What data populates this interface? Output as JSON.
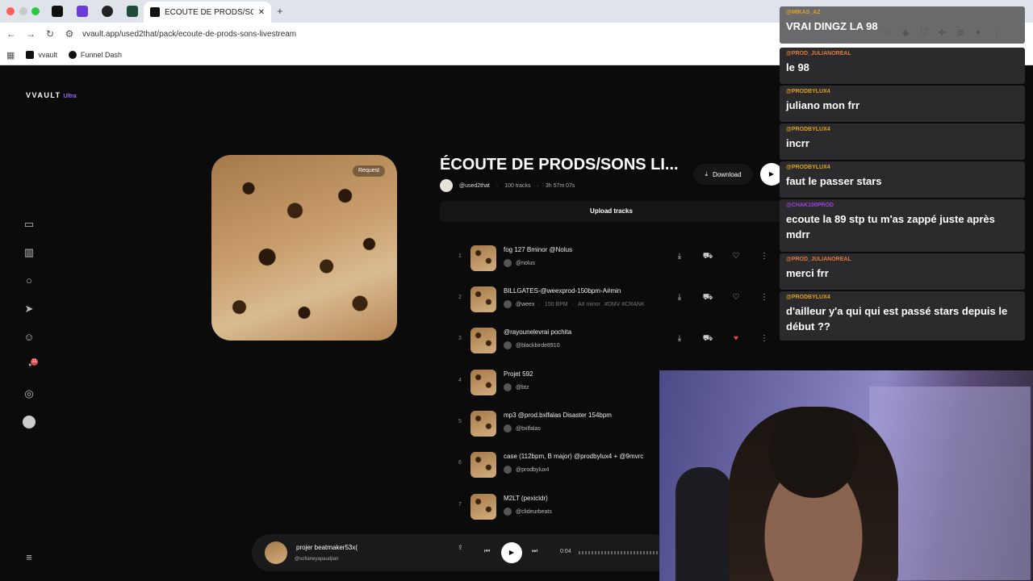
{
  "browser": {
    "active_tab_title": "ÉCOUTE DE PRODS/SONS LI",
    "new_tab_symbol": "+",
    "url": "vvault.app/used2that/pack/ecoute-de-prods-sons-livestream",
    "bookmarks": [
      "vvault",
      "Funnel Dash"
    ]
  },
  "app": {
    "brand": "VVAULT",
    "brand_tier": "Ultra",
    "notification_count": "11"
  },
  "pack": {
    "request_label": "Request",
    "title": "ÉCOUTE DE PRODS/SONS LI...",
    "owner": "@used2that",
    "track_count": "100 tracks",
    "duration": "3h 57m 07s",
    "download_label": "Download",
    "upload_label": "Upload tracks"
  },
  "tracks": [
    {
      "num": "1",
      "name": "fog 127 Bminor @Nolus",
      "user": "@nolus",
      "bpm": "",
      "key": "",
      "tags": "",
      "liked": false
    },
    {
      "num": "2",
      "name": "BILLGATES-@weexprod-150bpm-A#min",
      "user": "@weex",
      "bpm": "150 BPM",
      "key": "A# minor",
      "tags": "#DMV #CRANK",
      "liked": false
    },
    {
      "num": "3",
      "name": "@rayounelevrai pochita",
      "user": "@blackbirde8910",
      "bpm": "",
      "key": "",
      "tags": "",
      "liked": true
    },
    {
      "num": "4",
      "name": "Projet 592",
      "user": "@btz",
      "bpm": "",
      "key": "",
      "tags": ""
    },
    {
      "num": "5",
      "name": "mp3 @prod.bxlfalas Disaster 154bpm",
      "user": "@bxlfalas",
      "bpm": "",
      "key": "",
      "tags": ""
    },
    {
      "num": "6",
      "name": "case (112bpm, B major) @prodbylux4 + @9mvrc",
      "user": "@prodbylux4",
      "bpm": "",
      "key": "",
      "tags": ""
    },
    {
      "num": "7",
      "name": "M2LT (pexicldr)",
      "user": "@clideurbeats",
      "bpm": "",
      "key": "",
      "tags": ""
    }
  ],
  "player": {
    "title": "projer beatmaker53x(",
    "artist": "@sofianeyapaudjian",
    "time": "0:04"
  },
  "chat": [
    {
      "author": "@MIKAS_AZ",
      "text": "VRAI DINGZ LA 98",
      "color": "#e0a020"
    },
    {
      "author": "@PROD_JULIANOREAL",
      "text": "le 98",
      "color": "#e07a40"
    },
    {
      "author": "@PRODBYLUX4",
      "text": "juliano mon frr",
      "color": "#e0a020"
    },
    {
      "author": "@PRODBYLUX4",
      "text": "incrr",
      "color": "#e0a020"
    },
    {
      "author": "@PRODBYLUX4",
      "text": "faut le passer stars",
      "color": "#e0a020"
    },
    {
      "author": "@CHAK100PROD",
      "text": "ecoute la 89 stp tu m'as zappé juste après mdrr",
      "color": "#a040e0"
    },
    {
      "author": "@PROD_JULIANOREAL",
      "text": "merci frr",
      "color": "#e07a40"
    },
    {
      "author": "@PRODBYLUX4",
      "text": "d'ailleur y'a qui qui est passé stars depuis le début ??",
      "color": "#e0a020"
    }
  ]
}
